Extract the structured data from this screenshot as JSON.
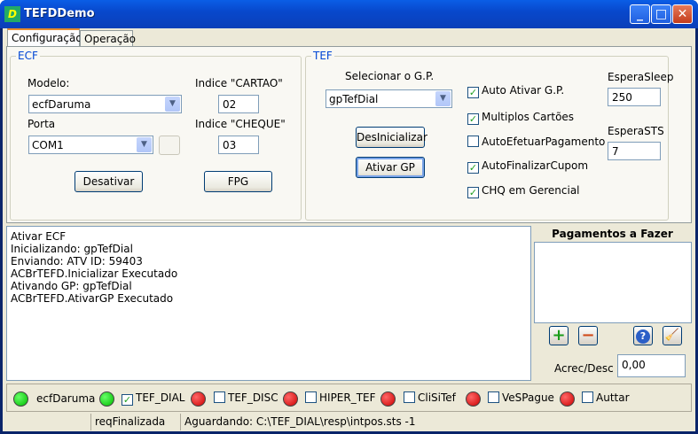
{
  "window": {
    "title": "TEFDDemo",
    "icon": "delphi-app-icon"
  },
  "tabs": [
    {
      "label": "Configuração",
      "active": true
    },
    {
      "label": "Operação",
      "active": false
    }
  ],
  "ecf": {
    "group_label": "ECF",
    "modelo_label": "Modelo:",
    "modelo_value": "ecfDaruma",
    "porta_label": "Porta",
    "porta_value": "COM1",
    "indice_cartao_label": "Indice \"CARTAO\"",
    "indice_cartao_value": "02",
    "indice_cheque_label": "Indice \"CHEQUE\"",
    "indice_cheque_value": "03",
    "desativar_label": "Desativar",
    "fpg_label": "FPG"
  },
  "tef": {
    "group_label": "TEF",
    "selecionar_label": "Selecionar o G.P.",
    "gp_value": "gpTefDial",
    "desinicializar_label": "DesInicializar",
    "ativar_gp_label": "Ativar GP",
    "checks": [
      {
        "label": "Auto Ativar G.P.",
        "checked": true
      },
      {
        "label": "Multiplos Cartões",
        "checked": true
      },
      {
        "label": "AutoEfetuarPagamento",
        "checked": false
      },
      {
        "label": "AutoFinalizarCupom",
        "checked": true
      },
      {
        "label": "CHQ em Gerencial",
        "checked": true
      }
    ],
    "espera_sleep_label": "EsperaSleep",
    "espera_sleep_value": "250",
    "espera_sts_label": "EsperaSTS",
    "espera_sts_value": "7"
  },
  "log": {
    "lines": [
      "Ativar ECF",
      "Inicializando: gpTefDial",
      "Enviando: ATV ID: 59403",
      "ACBrTEFD.Inicializar Executado",
      "Ativando GP: gpTefDial",
      "ACBrTEFD.AtivarGP Executado"
    ]
  },
  "pagamentos": {
    "title": "Pagamentos a Fazer",
    "acrec_label": "Acrec/Desc",
    "acrec_value": "0,00"
  },
  "status": {
    "ecf_label": "ecfDaruma",
    "items": [
      {
        "label": "TEF_DIAL",
        "checked": true,
        "led": "green"
      },
      {
        "label": "TEF_DISC",
        "checked": false,
        "led": "red"
      },
      {
        "label": "HIPER_TEF",
        "checked": false,
        "led": "red"
      },
      {
        "label": "CliSiTef",
        "checked": false,
        "led": "red"
      },
      {
        "label": "VeSPague",
        "checked": false,
        "led": "red"
      },
      {
        "label": "Auttar",
        "checked": false,
        "led": "red"
      }
    ]
  },
  "statusbar": {
    "cell1": "",
    "cell2": "reqFinalizada",
    "cell3": "Aguardando: C:\\TEF_DIAL\\resp\\intpos.sts -1"
  }
}
